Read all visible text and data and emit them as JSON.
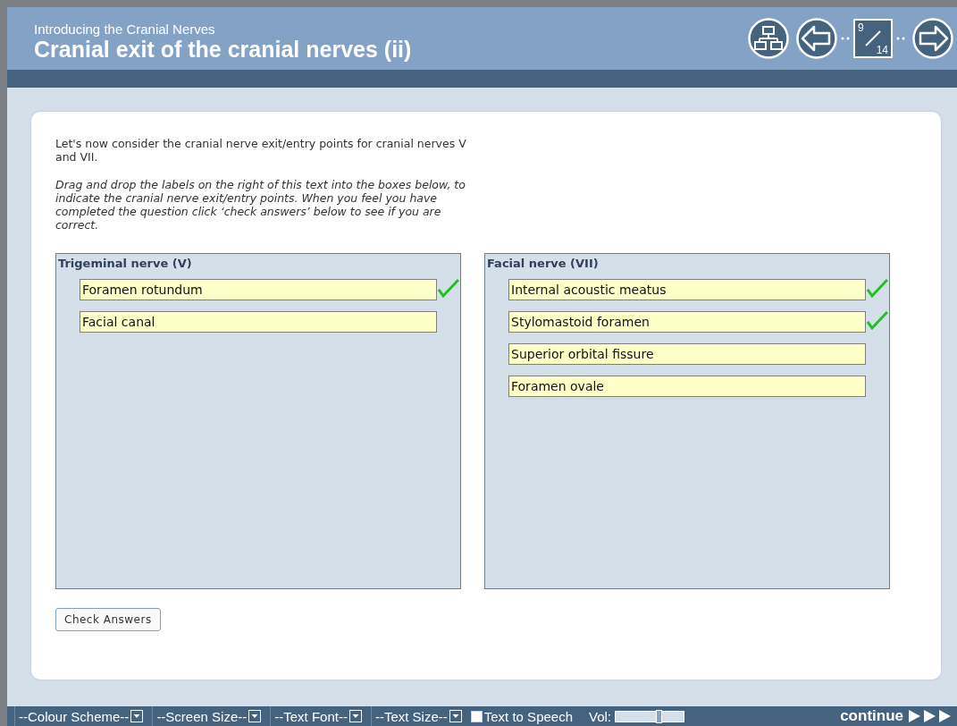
{
  "header": {
    "subtitle": "Introducing the Cranial Nerves",
    "title": "Cranial exit of the cranial nerves (ii)",
    "page": {
      "current": "9",
      "total": "14"
    }
  },
  "intro": "Let's now consider the cranial nerve exit/entry points for cranial nerves V and VII.",
  "instructions": "Drag and drop the labels on the right of this text into the boxes below, to indicate the cranial nerve exit/entry points. When you feel you have completed the question click ‘check answers’ below to see if you are correct.",
  "drop_zones": [
    {
      "heading": "Trigeminal nerve (V)",
      "labels": [
        {
          "text": "Foramen rotundum",
          "correct": true
        },
        {
          "text": "Facial canal",
          "correct": false
        }
      ]
    },
    {
      "heading": "Facial nerve (VII)",
      "labels": [
        {
          "text": "Internal acoustic meatus",
          "correct": true
        },
        {
          "text": "Stylomastoid foramen",
          "correct": true
        },
        {
          "text": "Superior orbital fissure",
          "correct": false
        },
        {
          "text": "Foramen ovale",
          "correct": false
        }
      ]
    }
  ],
  "check_button": "Check Answers",
  "toolbar": {
    "dropdowns": [
      "--Colour Scheme--",
      "--Screen Size--",
      "--Text Font--",
      "--Text Size--"
    ],
    "text_to_speech": {
      "label": "Text to Speech",
      "checked": false
    },
    "volume": {
      "label": "Vol:",
      "level": 0.65
    },
    "continue": "continue"
  }
}
